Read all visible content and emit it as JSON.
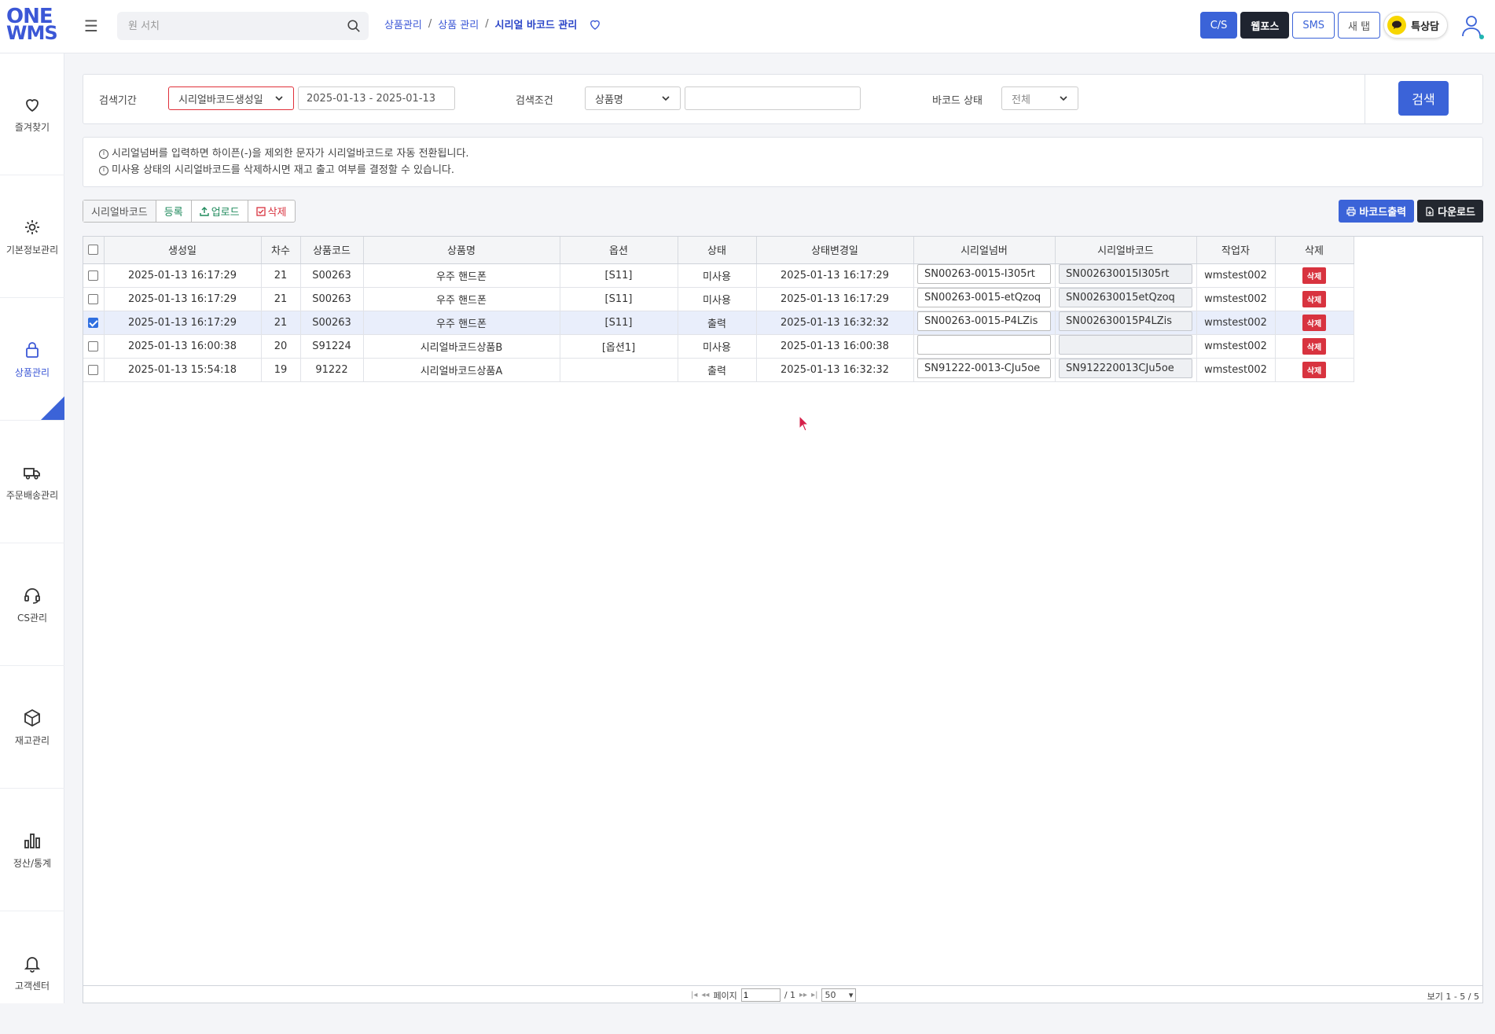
{
  "app": {
    "logo_line1": "ONE",
    "logo_line2": "WMS"
  },
  "search": {
    "placeholder": "원 서치"
  },
  "breadcrumb": {
    "item1": "상품관리",
    "item2": "상품 관리",
    "current": "시리얼 바코드 관리",
    "sep": "/"
  },
  "top_buttons": {
    "cs": "C/S",
    "webpos": "웹포스",
    "sms": "SMS",
    "newtab": "새 탭",
    "kakao": "특상담"
  },
  "sidebar": [
    {
      "label": "즐겨찾기",
      "icon": "heart-icon"
    },
    {
      "label": "기본정보관리",
      "icon": "gear-icon"
    },
    {
      "label": "상품관리",
      "icon": "lock-bag-icon",
      "active": true
    },
    {
      "label": "주문배송관리",
      "icon": "truck-icon"
    },
    {
      "label": "CS관리",
      "icon": "headset-icon"
    },
    {
      "label": "재고관리",
      "icon": "box-icon"
    },
    {
      "label": "정산/통계",
      "icon": "bar-chart-icon"
    },
    {
      "label": "고객센터",
      "icon": "bell-icon"
    }
  ],
  "filters": {
    "period_label": "검색기간",
    "period_type": "시리얼바코드생성일",
    "date_range": "2025-01-13 - 2025-01-13",
    "condition_label": "검색조건",
    "condition_type": "상품명",
    "condition_value": "",
    "status_label": "바코드 상태",
    "status_value": "전체",
    "search_button": "검색"
  },
  "notice": {
    "line1": "시리얼넘버를 입력하면 하이픈(-)을 제외한 문자가 시리얼바코드로 자동 전환됩니다.",
    "line2": "미사용 상태의 시리얼바코드를 삭제하시면 재고 출고 여부를 결정할 수 있습니다."
  },
  "toolbar": {
    "title": "시리얼바코드",
    "register": "등록",
    "upload": "업로드",
    "delete": "삭제",
    "print": "바코드출력",
    "download": "다운로드"
  },
  "table": {
    "headers": [
      "생성일",
      "차수",
      "상품코드",
      "상품명",
      "옵션",
      "상태",
      "상태변경일",
      "시리얼넘버",
      "시리얼바코드",
      "작업자",
      "삭제"
    ],
    "delete_label": "삭제",
    "rows": [
      {
        "checked": false,
        "created": "2025-01-13 16:17:29",
        "round": "21",
        "code": "S00263",
        "name": "우주 핸드폰",
        "option": "[S11]",
        "status": "미사용",
        "changed": "2025-01-13 16:17:29",
        "serial": "SN00263-0015-I305rt",
        "barcode": "SN002630015I305rt",
        "worker": "wmstest002"
      },
      {
        "checked": false,
        "created": "2025-01-13 16:17:29",
        "round": "21",
        "code": "S00263",
        "name": "우주 핸드폰",
        "option": "[S11]",
        "status": "미사용",
        "changed": "2025-01-13 16:17:29",
        "serial": "SN00263-0015-etQzoq",
        "barcode": "SN002630015etQzoq",
        "worker": "wmstest002"
      },
      {
        "checked": true,
        "created": "2025-01-13 16:17:29",
        "round": "21",
        "code": "S00263",
        "name": "우주 핸드폰",
        "option": "[S11]",
        "status": "출력",
        "changed": "2025-01-13 16:32:32",
        "serial": "SN00263-0015-P4LZis",
        "barcode": "SN002630015P4LZis",
        "worker": "wmstest002"
      },
      {
        "checked": false,
        "created": "2025-01-13 16:00:38",
        "round": "20",
        "code": "S91224",
        "name": "시리얼바코드상품B",
        "option": "[옵션1]",
        "status": "미사용",
        "changed": "2025-01-13 16:00:38",
        "serial": "",
        "barcode": "",
        "worker": "wmstest002"
      },
      {
        "checked": false,
        "created": "2025-01-13 15:54:18",
        "round": "19",
        "code": "91222",
        "name": "시리얼바코드상품A",
        "option": "",
        "status": "출력",
        "changed": "2025-01-13 16:32:32",
        "serial": "SN91222-0013-CJu5oe",
        "barcode": "SN912220013CJu5oe",
        "worker": "wmstest002"
      }
    ]
  },
  "pager": {
    "page_label": "페이지",
    "page_value": "1",
    "total_pages": "/ 1",
    "page_size": "50",
    "view_info": "보기 1 - 5 / 5"
  },
  "colors": {
    "accent": "#3b63d8",
    "danger": "#d8333f",
    "dark": "#23272f"
  }
}
